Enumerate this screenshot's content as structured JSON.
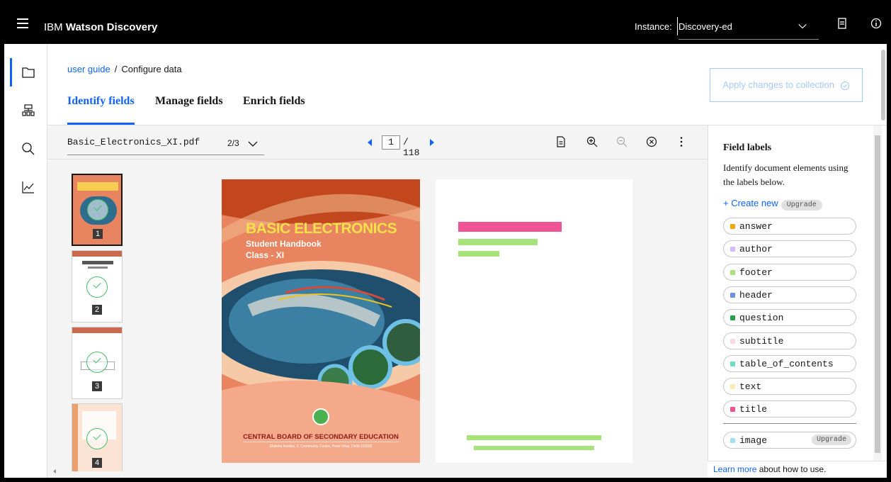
{
  "header": {
    "brand_prefix": "IBM",
    "brand_name": "Watson Discovery",
    "instance_label": "Instance:",
    "instance_value": "Discovery-ed"
  },
  "breadcrumb": {
    "link": "user guide",
    "separator": "/",
    "current": "Configure data"
  },
  "tabs": [
    {
      "label": "Identify fields",
      "active": true
    },
    {
      "label": "Manage fields",
      "active": false
    },
    {
      "label": "Enrich fields",
      "active": false
    }
  ],
  "apply_button": "Apply changes to collection",
  "viewer": {
    "document_name": "Basic_Electronics_XI.pdf",
    "document_count": "2/3",
    "page_current": "1",
    "page_total": "/ 118",
    "thumbnails": [
      "1",
      "2",
      "3",
      "4"
    ]
  },
  "cover": {
    "title": "BASIC ELECTRONICS",
    "subtitle": "Student Handbook",
    "class": "Class - XI",
    "board": "CENTRAL BOARD OF SECONDARY EDUCATION",
    "address": "Shiksha Kendra, 2, Community Centre, Preet Vihar, Delhi-110092"
  },
  "panel": {
    "title": "Field labels",
    "description": "Identify document elements using the labels below.",
    "create_new": "+ Create new",
    "upgrade": "Upgrade",
    "labels": [
      {
        "name": "answer",
        "color": "#f1a60a"
      },
      {
        "name": "author",
        "color": "#d4bbff"
      },
      {
        "name": "footer",
        "color": "#a7e27a"
      },
      {
        "name": "header",
        "color": "#6f8fe0"
      },
      {
        "name": "question",
        "color": "#24a148"
      },
      {
        "name": "subtitle",
        "color": "#ffd6e8"
      },
      {
        "name": "table_of_contents",
        "color": "#6fdcc4"
      },
      {
        "name": "text",
        "color": "#fdebb0"
      },
      {
        "name": "title",
        "color": "#ee5396"
      }
    ],
    "image_label": {
      "name": "image",
      "color": "#a0e3ee",
      "badge": "Upgrade"
    },
    "learn_more_link": "Learn more",
    "learn_more_text": " about how to use."
  },
  "colors": {
    "accent": "#0f62fe",
    "title_highlight": "#ee5396",
    "footer_highlight": "#a7e27a"
  }
}
